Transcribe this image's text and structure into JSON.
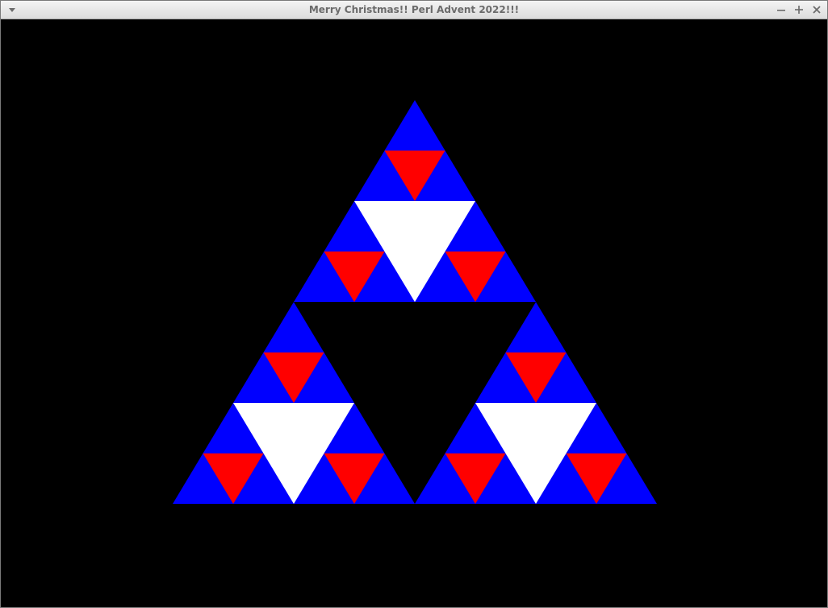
{
  "window": {
    "title": "Merry Christmas!!  Perl Advent 2022!!!",
    "menu_icon": "chevron-down-icon",
    "controls": [
      {
        "name": "minimize-button",
        "icon": "minus-icon"
      },
      {
        "name": "maximize-button",
        "icon": "plus-icon"
      },
      {
        "name": "close-button",
        "icon": "close-icon"
      }
    ]
  },
  "canvas": {
    "background": "#000000",
    "figure": "sierpinski-triangle",
    "colors": {
      "base": "#0000ff",
      "level1_hole": "#000000",
      "level2_hole": "#ffffff",
      "level3_hole": "#ff0000"
    }
  }
}
